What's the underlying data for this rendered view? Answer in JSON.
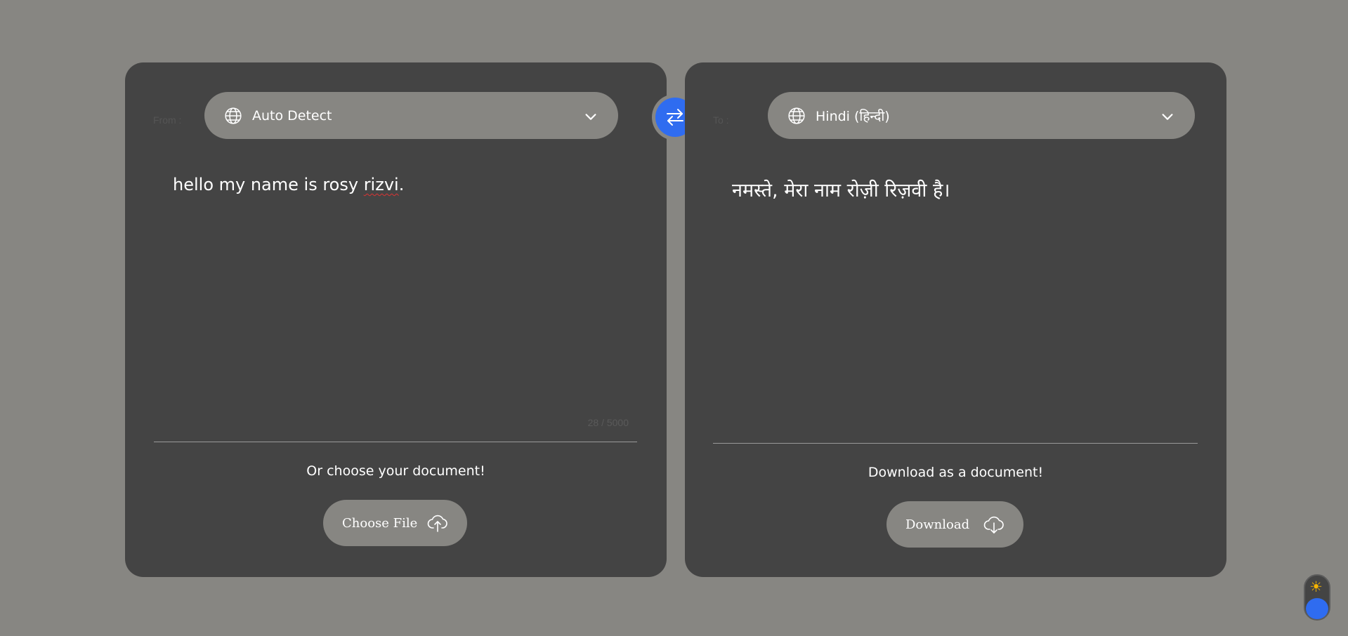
{
  "source": {
    "label": "From :",
    "language": "Auto Detect",
    "text_before": "hello my name is rosy ",
    "text_misspelled": "rizvi",
    "text_after": ".",
    "char_count": "28 / 5000",
    "hint": "Or choose your document!",
    "button_label": "Choose File",
    "icons": {
      "language": "globe-icon",
      "dropdown": "chevron-down-icon",
      "button": "cloud-upload-icon"
    }
  },
  "target": {
    "label": "To :",
    "language": "Hindi (हिन्दी)",
    "text": "नमस्ते, मेरा नाम रोज़ी रिज़वी है।",
    "hint": "Download as a document!",
    "button_label": "Download",
    "icons": {
      "language": "globe-icon",
      "dropdown": "chevron-down-icon",
      "button": "cloud-download-icon"
    }
  },
  "swap": {
    "icon": "swap-arrows-icon"
  },
  "theme_toggle": {
    "icon": "sun-icon",
    "mode": "dark"
  },
  "colors": {
    "background": "#878682",
    "panel": "#444444",
    "accent": "#2f6cf0",
    "pill": "#878682",
    "text": "#ffffff"
  }
}
